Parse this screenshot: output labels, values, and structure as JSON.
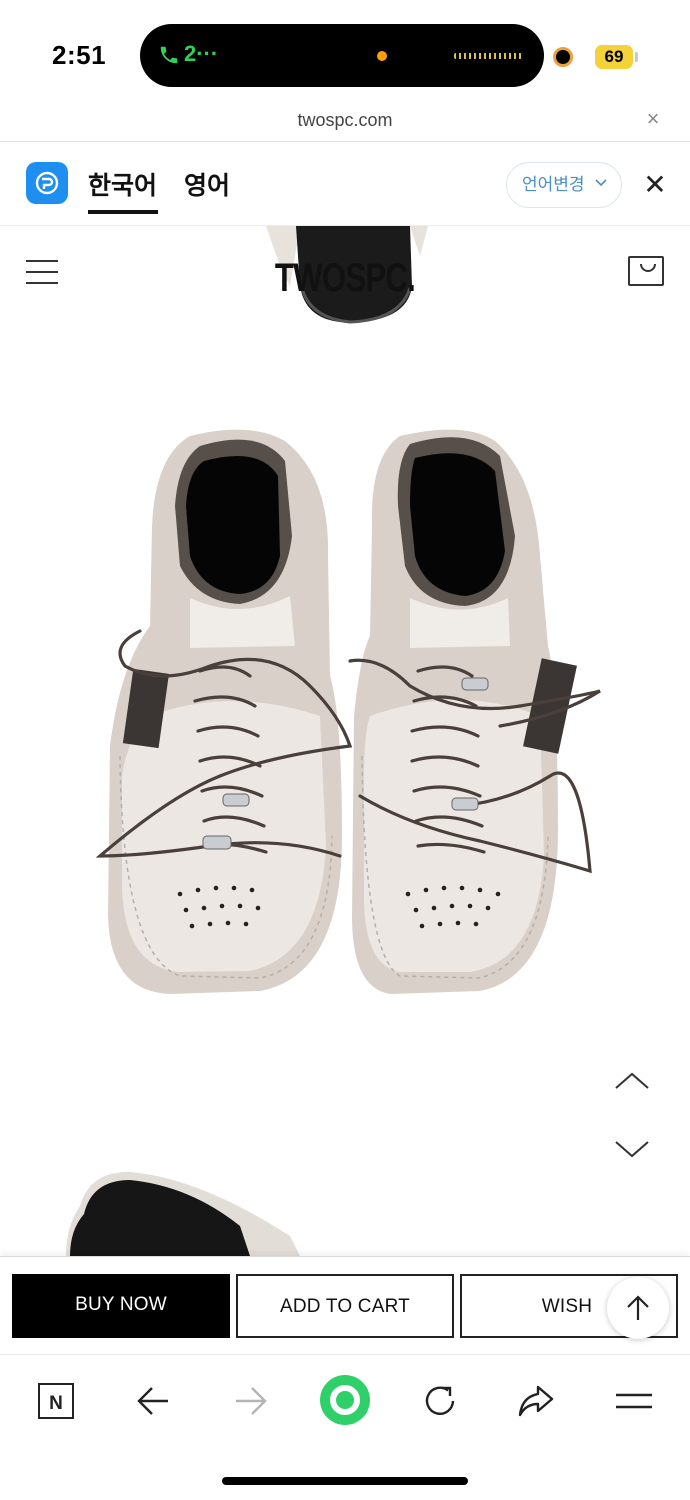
{
  "status_bar": {
    "time": "2:51",
    "call_indicator": "2···",
    "battery_level": "69",
    "colors": {
      "call_green": "#31d158",
      "battery_yellow": "#f4d23a"
    }
  },
  "url_bar": {
    "domain": "twospc.com"
  },
  "translate_bar": {
    "source_lang": "한국어",
    "target_lang": "영어",
    "change_language": "언어변경",
    "icons": {
      "app": "papago-icon",
      "close": "close-icon"
    }
  },
  "site": {
    "logo": "TWOSPC."
  },
  "purchase_bar": {
    "buy_now": "BUY NOW",
    "add_to_cart": "ADD TO CART",
    "wish": "WISH"
  },
  "browser_toolbar": {
    "icons": [
      "naver-n-icon",
      "back-arrow-icon",
      "forward-arrow-icon",
      "green-action-icon",
      "reload-icon",
      "share-icon",
      "menu-icon"
    ]
  },
  "accent_colors": {
    "link_blue": "#4a8fc4",
    "papago_blue": "#1e8ff0",
    "action_green": "#2fd06a"
  }
}
